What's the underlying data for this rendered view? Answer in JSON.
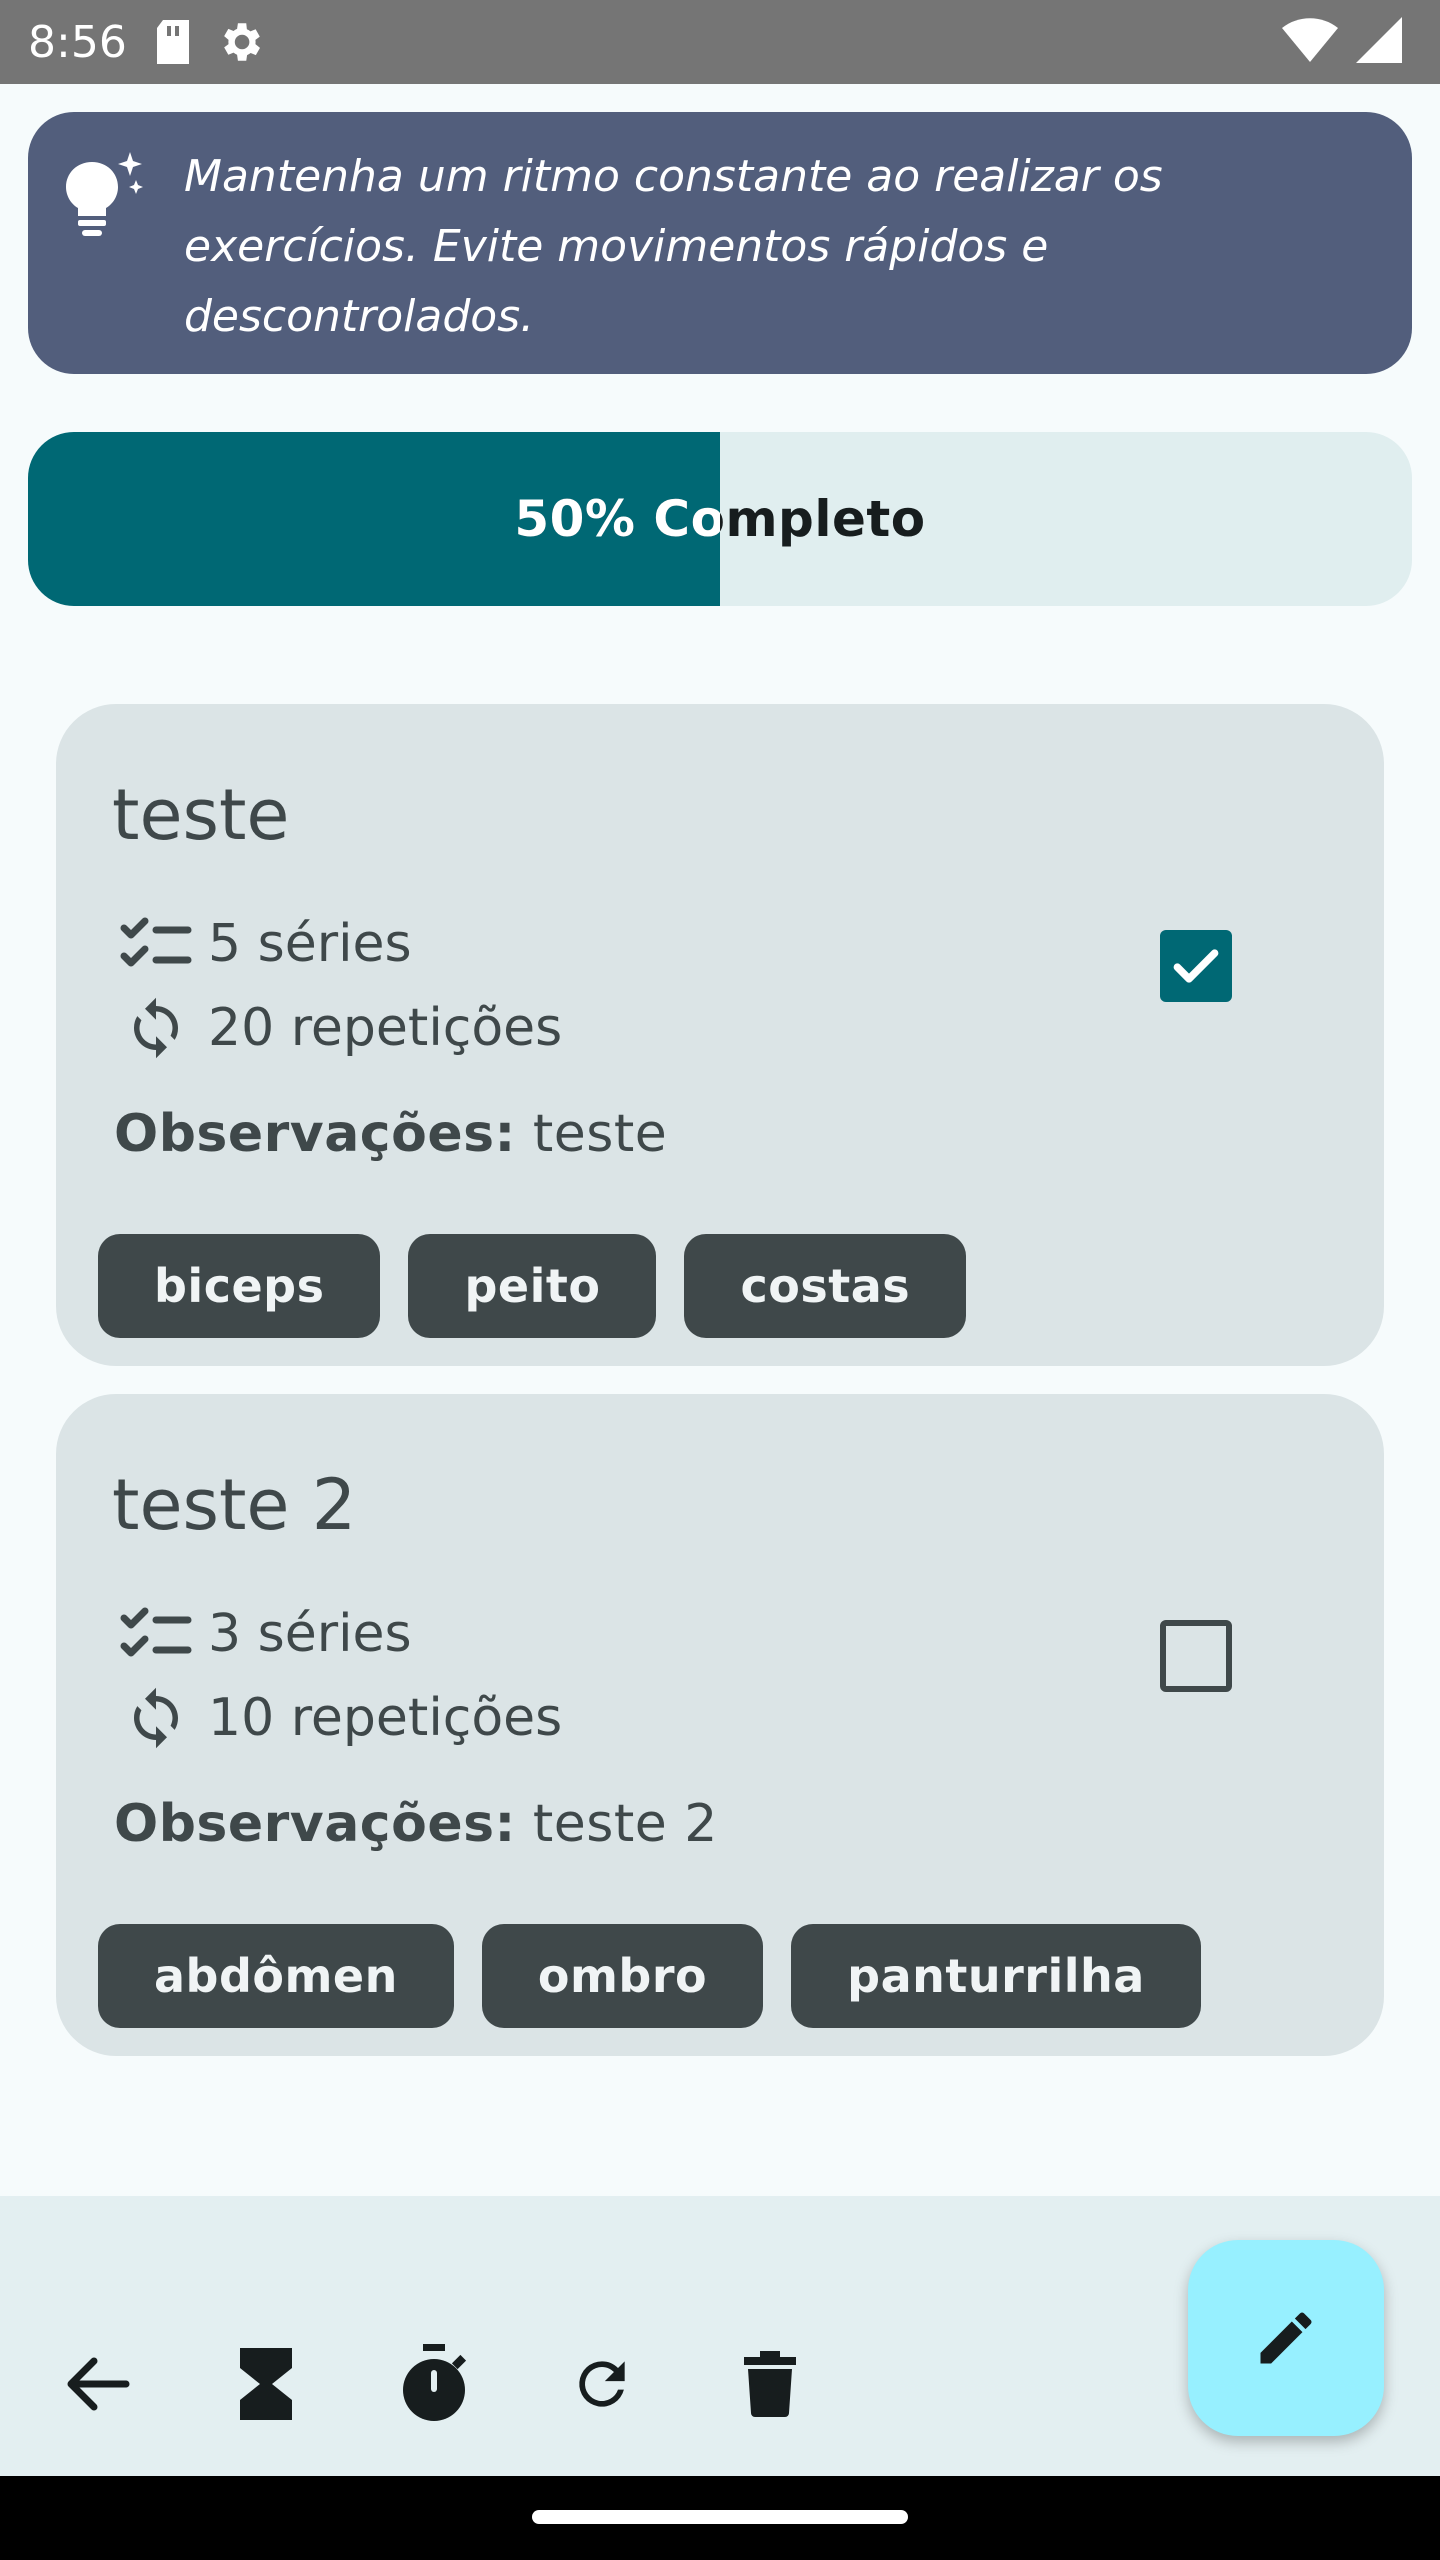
{
  "status_bar": {
    "time": "8:56",
    "icons": [
      "sd-card-icon",
      "settings-gear-icon",
      "wifi-icon",
      "cell-signal-icon"
    ]
  },
  "tip": {
    "icon": "lightbulb-sparkle-icon",
    "text": "Mantenha um ritmo constante ao realizar os exercícios. Evite movimentos rápidos e descontrolados."
  },
  "progress": {
    "label": "50% Completo",
    "value": 0.5
  },
  "exercises": [
    {
      "title": "teste",
      "series": "5 séries",
      "reps": "20 repetições",
      "obs_label": "Observações:",
      "obs_value": "teste",
      "checked": true,
      "tags": [
        "biceps",
        "peito",
        "costas"
      ]
    },
    {
      "title": "teste 2",
      "series": "3 séries",
      "reps": "10 repetições",
      "obs_label": "Observações:",
      "obs_value": "teste 2",
      "checked": false,
      "tags": [
        "abdômen",
        "ombro",
        "panturrilha"
      ]
    }
  ],
  "bottom_bar": {
    "actions": [
      "back-arrow-icon",
      "hourglass-icon",
      "stopwatch-icon",
      "refresh-icon",
      "delete-icon"
    ],
    "fab_icon": "edit-pencil-icon"
  },
  "colors": {
    "tip_bg": "#525e7c",
    "progress_fill": "#006874",
    "progress_track": "#e0eeef",
    "card_bg": "#dbe4e6",
    "chip_bg": "#3f484a",
    "fab_bg": "#97f0ff"
  }
}
